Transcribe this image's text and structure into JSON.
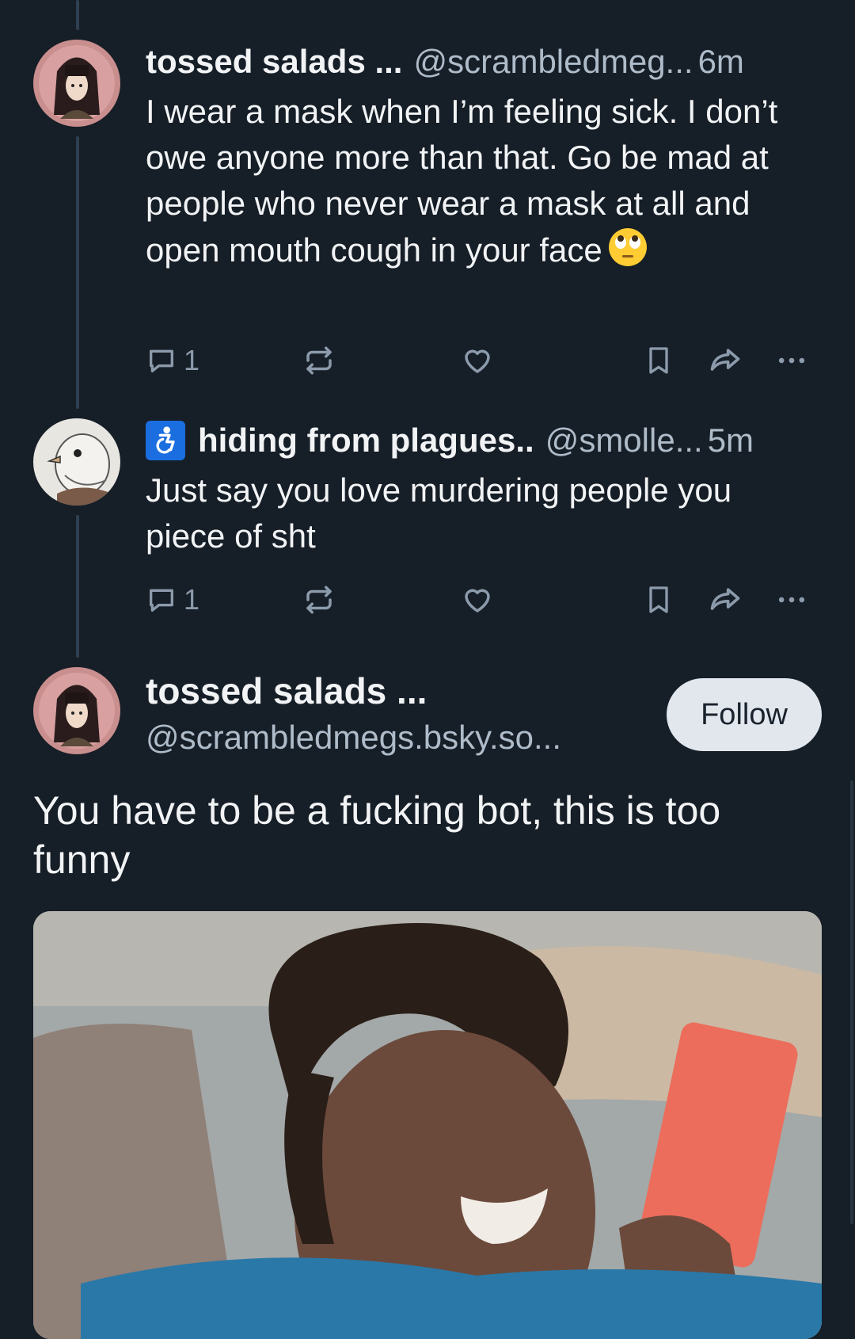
{
  "thread": [
    {
      "author_name": "tossed salads ...",
      "handle": "@scrambledmeg...",
      "time": "6m",
      "text": "I wear a mask when I’m feeling sick. I don’t owe anyone more than that. Go be mad at people who never wear a mask at all and open mouth cough in your face",
      "emoji": "face-with-rolling-eyes",
      "reply_count": "1"
    },
    {
      "badge": "accessibility-icon",
      "author_name": "hiding from plagues..",
      "handle": "@smolle...",
      "time": "5m",
      "text": "Just say you love murdering people you piece of sht",
      "reply_count": "1"
    }
  ],
  "main_post": {
    "author_name": "tossed salads ...",
    "handle": "@scrambledmegs.bsky.so...",
    "follow_label": "Follow",
    "text": "You have to be a fucking bot, this is too funny"
  },
  "colors": {
    "background": "#161e27",
    "text": "#f1f3f5",
    "secondary_text": "#aebbc9",
    "icon": "#8c9bab",
    "thread_line": "#2e4052",
    "badge": "#1a6ee0",
    "follow_bg": "#e2e7ee"
  }
}
